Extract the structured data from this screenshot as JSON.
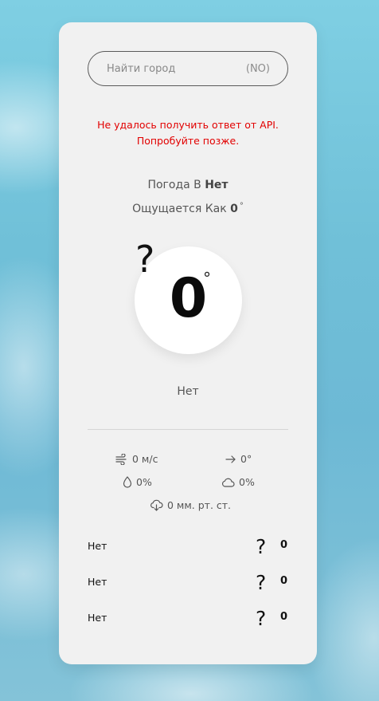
{
  "search": {
    "placeholder": "Найти город",
    "country": "(NO)"
  },
  "error": {
    "line1": "Не удалось получить ответ от API.",
    "line2": "Попробуйте позже."
  },
  "current": {
    "city_prefix": "Погода В",
    "city": "Нет",
    "feels_prefix": "Ощущается Как",
    "feels_value": "0",
    "degree_symbol": "°",
    "icon_symbol": "?",
    "temperature": "0",
    "description": "Нет"
  },
  "stats": {
    "wind": "0 м/с",
    "wind_direction": "0°",
    "humidity": "0%",
    "clouds": "0%",
    "pressure": "0 мм. рт. ст."
  },
  "forecast": [
    {
      "day": "Нет",
      "icon_symbol": "?",
      "temp": "0"
    },
    {
      "day": "Нет",
      "icon_symbol": "?",
      "temp": "0"
    },
    {
      "day": "Нет",
      "icon_symbol": "?",
      "temp": "0"
    }
  ],
  "icons": {
    "wind": "wind-icon",
    "direction": "arrow-right-icon",
    "humidity": "drop-icon",
    "clouds": "cloud-icon",
    "pressure": "cloud-download-icon"
  },
  "colors": {
    "card_background": "#f1f1f1",
    "error_text": "#e20000",
    "sky": "#78c6de"
  }
}
